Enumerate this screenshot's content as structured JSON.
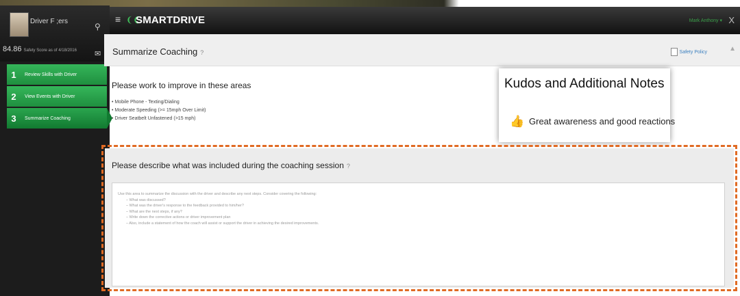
{
  "sidebar": {
    "driver_name": "Driver F ;ers",
    "score": "84.86",
    "score_note": "Safety Score as of 4/18/2016",
    "steps": [
      {
        "num": "1",
        "label": "Review Skills with Driver"
      },
      {
        "num": "2",
        "label": "View Events with Driver"
      },
      {
        "num": "3",
        "label": "Summarize Coaching"
      }
    ]
  },
  "header": {
    "logo": "SMARTDRIVE",
    "user_link": "Mark Anthony ▾",
    "close": "X"
  },
  "subheader": {
    "title": "Summarize Coaching",
    "safety_policy": "Safety Policy"
  },
  "improve": {
    "title": "Please work to improve in these areas",
    "items": [
      "• Mobile Phone - Texting/Dialing",
      "• Moderate Speeding (>= 15mph Over Limit)",
      "• Driver Seatbelt Unfastened (>15 mph)"
    ]
  },
  "kudos": {
    "title": "Kudos and Additional Notes",
    "note": "Great awareness and good reactions"
  },
  "coaching": {
    "label": "Please describe what was included during the coaching session",
    "placeholder_lines": [
      "Use this area to summarize the discussion with the driver and describe any next steps. Consider covering the following:",
      "– What was discussed?",
      "– What was the driver's response to the feedback provided to him/her?",
      "– What are the next steps, if any?",
      "– Write down the corrective actions or driver improvement plan",
      "– Also, include a statement of how the coach will assist or support the driver in achieving the desired improvements."
    ]
  }
}
